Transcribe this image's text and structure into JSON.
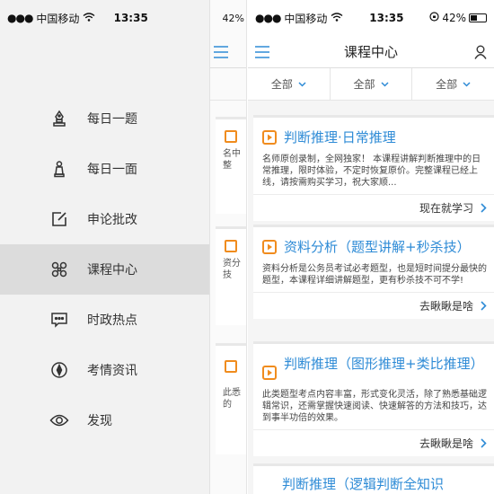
{
  "status_left": {
    "signal": "●●●",
    "carrier": "中国移动",
    "wifi": "wifi-icon",
    "time": "13:35"
  },
  "status_mid": {
    "battery": "42%"
  },
  "status_right": {
    "signal": "●●●",
    "carrier": "中国移动",
    "wifi": "wifi-icon",
    "time": "13:35",
    "battery": "42%",
    "battery_level": 0.42
  },
  "sidebar": {
    "items": [
      {
        "label": "每日一题",
        "icon": "chess-bishop-icon",
        "active": false
      },
      {
        "label": "每日一面",
        "icon": "chess-pawn-icon",
        "active": false
      },
      {
        "label": "申论批改",
        "icon": "edit-icon",
        "active": false
      },
      {
        "label": "课程中心",
        "icon": "command-icon",
        "active": true
      },
      {
        "label": "时政热点",
        "icon": "chat-bubble-icon",
        "active": false
      },
      {
        "label": "考情资讯",
        "icon": "compass-icon",
        "active": false
      },
      {
        "label": "发现",
        "icon": "eye-icon",
        "active": false
      }
    ]
  },
  "sliver": {
    "cards": [
      {
        "text": "名中整"
      },
      {
        "text": "资分技"
      },
      {
        "text": "此悉的"
      }
    ]
  },
  "header": {
    "title": "课程中心"
  },
  "filters": [
    {
      "label": "全部"
    },
    {
      "label": "全部"
    },
    {
      "label": "全部"
    }
  ],
  "courses": [
    {
      "title": "判断推理·日常推理",
      "desc": "名师原创录制，全网独家！ 本课程讲解判断推理中的日常推理，限时体验，不定时恢复原价。完整课程已经上线，请按需购买学习，祝大家顺...",
      "action": "现在就学习"
    },
    {
      "title": "资料分析（题型讲解+秒杀技）",
      "desc": "资料分析是公务员考试必考题型，也是短时间提分最快的题型，本课程详细讲解题型，更有秒杀技不可不学!",
      "action": "去瞅瞅是啥"
    },
    {
      "title": "判断推理（图形推理+类比推理）",
      "desc": "此类题型考点内容丰富，形式变化灵活，除了熟悉基础逻辑常识，还需掌握快速阅读、快速解答的方法和技巧，达到事半功倍的效果。",
      "action": "去瞅瞅是啥"
    },
    {
      "title": "判断推理（逻辑判断全知识",
      "desc": "",
      "action": ""
    }
  ],
  "colors": {
    "accent": "#2e8bd6",
    "course_icon": "#f08c1e",
    "active_bg": "#dcdcdc"
  }
}
